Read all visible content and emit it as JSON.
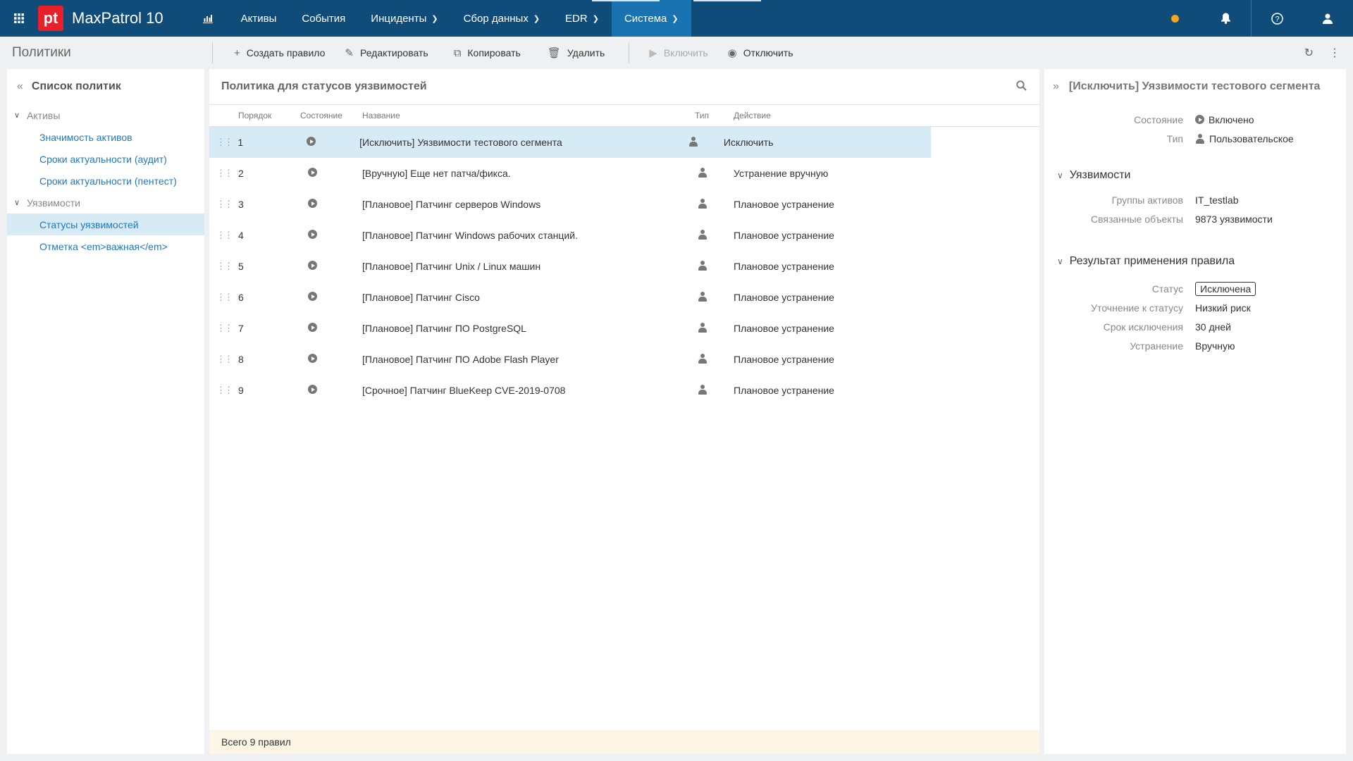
{
  "app": {
    "logo_text": "pt",
    "title": "MaxPatrol 10"
  },
  "nav": [
    {
      "label": "Активы",
      "dropdown": false,
      "active": false
    },
    {
      "label": "События",
      "dropdown": false,
      "active": false
    },
    {
      "label": "Инциденты",
      "dropdown": true,
      "active": false
    },
    {
      "label": "Сбор данных",
      "dropdown": true,
      "active": false
    },
    {
      "label": "EDR",
      "dropdown": true,
      "active": false
    },
    {
      "label": "Система",
      "dropdown": true,
      "active": true
    }
  ],
  "colors": {
    "header": "#0f4c7a",
    "active_nav": "#1873b0",
    "accent_link": "#1f78bf",
    "selection": "#d7ebf6",
    "logo": "#e8202a",
    "status_dot": "#f4a51f",
    "footer": "#fdf5e6"
  },
  "toolbar": {
    "page_title": "Политики",
    "create": "Создать правило",
    "edit": "Редактировать",
    "copy": "Копировать",
    "delete": "Удалить",
    "enable": "Включить",
    "disable": "Отключить"
  },
  "left_panel": {
    "title": "Список политик",
    "groups": [
      {
        "label": "Активы",
        "items": [
          "Значимость активов",
          "Сроки актуальности (аудит)",
          "Сроки актуальности (пентест)"
        ]
      },
      {
        "label": "Уязвимости",
        "items": [
          "Статусы уязвимостей",
          "Отметка <em>важная</em>"
        ]
      }
    ],
    "selected_item": "Статусы уязвимостей"
  },
  "table": {
    "title": "Политика для статусов уязвимостей",
    "columns": {
      "order": "Порядок",
      "state": "Состояние",
      "name": "Название",
      "type": "Тип",
      "action": "Действие"
    },
    "rows": [
      {
        "order": "1",
        "name": "[Исключить] Уязвимости тестового сегмента",
        "action": "Исключить",
        "selected": true
      },
      {
        "order": "2",
        "name": "[Вручную] Еще нет патча/фикса.",
        "action": "Устранение вручную"
      },
      {
        "order": "3",
        "name": "[Плановое] Патчинг серверов Windows",
        "action": "Плановое устранение"
      },
      {
        "order": "4",
        "name": "[Плановое] Патчинг Windows рабочих станций.",
        "action": "Плановое устранение"
      },
      {
        "order": "5",
        "name": "[Плановое] Патчинг Unix / Linux машин",
        "action": "Плановое устранение"
      },
      {
        "order": "6",
        "name": "[Плановое] Патчинг Cisco",
        "action": "Плановое устранение"
      },
      {
        "order": "7",
        "name": "[Плановое] Патчинг ПО PostgreSQL",
        "action": "Плановое устранение"
      },
      {
        "order": "8",
        "name": "[Плановое] Патчинг ПО Adobe Flash Player",
        "action": "Плановое устранение"
      },
      {
        "order": "9",
        "name": "[Срочное] Патчинг BlueKeep CVE-2019-0708",
        "action": "Плановое устранение"
      }
    ],
    "footer": "Всего 9 правил"
  },
  "details": {
    "title": "[Исключить] Уязвимости тестового сегмента",
    "state_label": "Состояние",
    "state_value": "Включено",
    "type_label": "Тип",
    "type_value": "Пользовательское",
    "vuln_section": "Уязвимости",
    "asset_groups_label": "Группы активов",
    "asset_groups_value": "IT_testlab",
    "related_label": "Связанные объекты",
    "related_value": "9873 уязвимости",
    "result_section": "Результат применения правила",
    "status_label": "Статус",
    "status_value": "Исключена",
    "refine_label": "Уточнение к статусу",
    "refine_value": "Низкий риск",
    "term_label": "Срок исключения",
    "term_value": "30 дней",
    "fix_label": "Устранение",
    "fix_value": "Вручную"
  }
}
